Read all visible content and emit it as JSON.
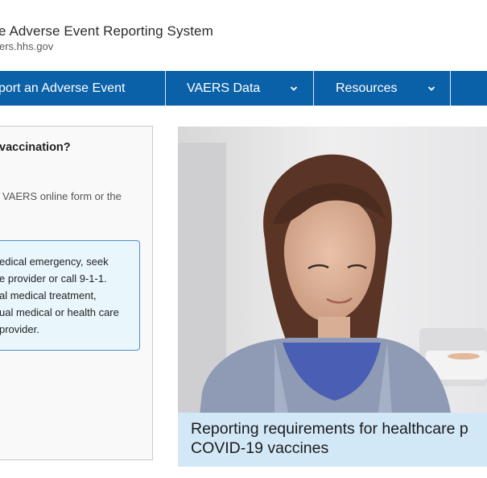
{
  "header": {
    "title": "e Adverse Event Reporting System",
    "url": "ers.hhs.gov"
  },
  "nav": {
    "items": [
      {
        "label": "port an Adverse Event"
      },
      {
        "label": "VAERS Data"
      },
      {
        "label": "Resources"
      }
    ]
  },
  "left_card": {
    "heading": "vaccination?",
    "text": "VAERS online form or the",
    "alert_lines": [
      "edical emergency, seek",
      "e provider or call 9-1-1.",
      "al medical treatment,",
      "ual medical or health care",
      "provider."
    ]
  },
  "feature": {
    "caption_lines": [
      "Reporting requirements for healthcare p",
      "COVID-19 vaccines"
    ]
  },
  "colors": {
    "nav_background": "#0b61a8",
    "alert_background": "#e9f6fc",
    "alert_border": "#4e8fc7",
    "caption_background": "#d2e8f6"
  }
}
